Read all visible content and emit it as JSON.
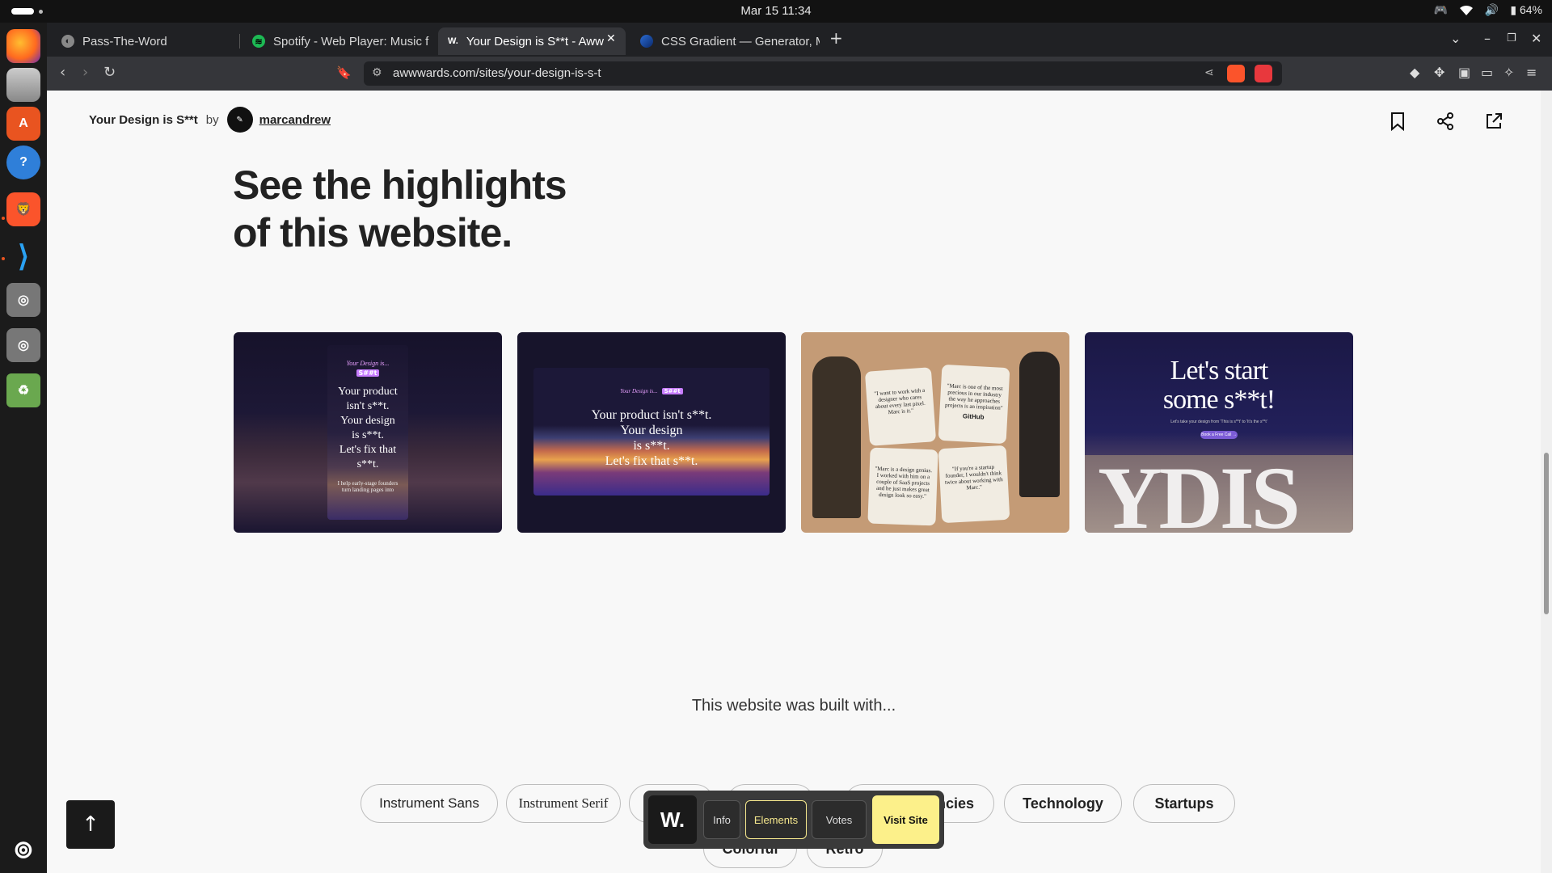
{
  "system": {
    "clock": "Mar 15  11:34",
    "battery": "64%"
  },
  "dock": {
    "items": [
      "Firefox",
      "Files",
      "App Center",
      "Help",
      "Brave",
      "VS Code",
      "Disk",
      "Disk",
      "Trash",
      "Show Apps"
    ]
  },
  "browser": {
    "tabs": [
      {
        "title": "Pass-The-Word",
        "fav": "globe-icon"
      },
      {
        "title": "Spotify - Web Player: Music f",
        "fav": "spotify-icon"
      },
      {
        "title": "Your Design is S**t - Aww",
        "fav": "W."
      },
      {
        "title": "CSS Gradient — Generator, M",
        "fav": "gradient-icon"
      }
    ],
    "new_tab": "+",
    "url": "awwwards.com/sites/your-design-is-s-t",
    "shield_count": "2",
    "alert_count": "1"
  },
  "page": {
    "site_name": "Your Design is S**t",
    "by": "by",
    "author": "marcandrew",
    "headline_line1": "See the highlights",
    "headline_line2": "of this website.",
    "built_with": "This website was built with...",
    "chips": [
      "Instrument Sans",
      "Instrument Serif",
      "ncies",
      "Technology",
      "Startups",
      "Colorful",
      "Retro"
    ],
    "thumbs": {
      "t1": {
        "small": "Your Design is...",
        "badge": "S##t",
        "lines": [
          "Your product",
          "isn't s**t.",
          "Your design",
          "is s**t.",
          "Let's fix that",
          "s**t."
        ],
        "foot": "I help early-stage founders turn landing pages into"
      },
      "t2": {
        "small": "Your Design is...",
        "badge": "S##t",
        "lines": [
          "Your product isn't s**t.",
          "Your design",
          "is s**t.",
          "Let's fix that s**t."
        ]
      },
      "t3": {
        "q1": "\"I want to work with a designer who cares about every last pixel. Marc is it.\"",
        "q2": "\"Marc is one of the most precious in our industry the way he approaches projects is an inspiration\"",
        "q3": "\"Marc is a design genius. I worked with him on a couple of SaaS projects and he just makes great design look so easy.\"",
        "q4": "\"If you're a startup founder, I wouldn't think twice about working with Marc.\"",
        "brand": "GitHub"
      },
      "t4": {
        "title1": "Let's start",
        "title2": "some s**t!",
        "sub": "Let's take your design from 'This is s**t' to 'It's the s**t'",
        "cta": "Book a Free Call →",
        "big": "YDIS"
      }
    }
  },
  "awwwards_bar": {
    "logo": "W.",
    "info": "Info",
    "elements": "Elements",
    "votes": "Votes",
    "visit": "Visit Site"
  },
  "to_top": "↑"
}
